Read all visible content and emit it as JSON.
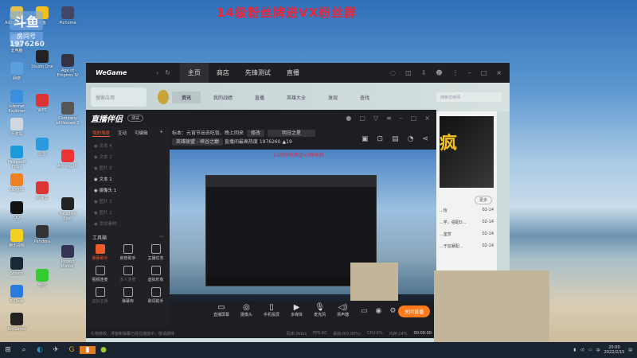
{
  "overlay": {
    "banner": "14级粉丝牌进VX粉丝群",
    "logo": "斗鱼",
    "room_label": "房间号",
    "room_id": "1976260"
  },
  "desktop_icons": [
    {
      "label": "Administrator",
      "color": "#e6c24a"
    },
    {
      "label": "此电脑",
      "color": "#7fb0e0"
    },
    {
      "label": "网络",
      "color": "#5aa0e0"
    },
    {
      "label": "Internet Explorer",
      "color": "#3a8fe0"
    },
    {
      "label": "回收站",
      "color": "#d0d8e0"
    },
    {
      "label": "Microsoft Edge",
      "color": "#1a9ad8"
    },
    {
      "label": "QQ游戏",
      "color": "#f08020"
    },
    {
      "label": "QQ",
      "color": "#111"
    },
    {
      "label": "腾讯视频",
      "color": "#f4d020"
    },
    {
      "label": "Steam",
      "color": "#1b2838"
    },
    {
      "label": "ToDesk",
      "color": "#2a7ae0"
    },
    {
      "label": "WeGame",
      "color": "#222"
    },
    {
      "label": "斗鱼",
      "color": "#f4c020"
    },
    {
      "label": "Studio One",
      "color": "#222"
    },
    {
      "label": "WPS",
      "color": "#d33"
    },
    {
      "label": "迅雷",
      "color": "#2a9ae0"
    },
    {
      "label": "网易云",
      "color": "#d33"
    },
    {
      "label": "Pandora",
      "color": "#333"
    },
    {
      "label": "微信",
      "color": "#3c3"
    },
    {
      "label": "Pichome",
      "color": "#446"
    },
    {
      "label": "Age of Empires IV",
      "color": "#334"
    },
    {
      "label": "Company of Heroes 2",
      "color": "#555"
    },
    {
      "label": "Among Us",
      "color": "#e33"
    },
    {
      "label": "Paradise Lost",
      "color": "#222"
    },
    {
      "label": "Project Winter",
      "color": "#335"
    }
  ],
  "wegame": {
    "brand": "WeGame",
    "nav": [
      "主页",
      "商店",
      "先锋测试",
      "直播"
    ],
    "search_placeholder": "搜索应用",
    "sub_tabs": [
      "资讯",
      "我的战绩",
      "直播",
      "英雄大全",
      "发现",
      "查找"
    ],
    "search2_placeholder": "搜索召唤师",
    "poster_text": "疯",
    "more": "更多",
    "news": [
      {
        "title": "...怡",
        "date": "02-14"
      },
      {
        "title": "...学，强配D...",
        "date": "02-14"
      },
      {
        "title": "...鉴赏",
        "date": "02-14"
      },
      {
        "title": "...于狂暴配...",
        "date": "02-14"
      }
    ]
  },
  "zhibo": {
    "brand": "直播伴侣",
    "version": "测试",
    "tabs": [
      "我的场景",
      "互动",
      "可编辑"
    ],
    "scenes": [
      {
        "name": "文本 4",
        "on": false
      },
      {
        "name": "文本 2",
        "on": false
      },
      {
        "name": "图片 5",
        "on": false
      },
      {
        "name": "文本 1",
        "on": true
      },
      {
        "name": "摄像头 1",
        "on": true
      },
      {
        "name": "图片 1",
        "on": false
      },
      {
        "name": "图片 2",
        "on": false
      },
      {
        "name": "添加素材",
        "on": false
      }
    ],
    "toolbox": "工具箱",
    "tools": [
      {
        "label": "弹幕助手",
        "style": "org"
      },
      {
        "label": "房管助手",
        "style": ""
      },
      {
        "label": "主播任务",
        "style": ""
      },
      {
        "label": "视频连麦",
        "style": ""
      },
      {
        "label": "多人连麦",
        "style": "dis"
      },
      {
        "label": "虚拟形象",
        "style": ""
      },
      {
        "label": "虚拟主播",
        "style": "dis"
      },
      {
        "label": "弹幕库",
        "style": ""
      },
      {
        "label": "歌词助手",
        "style": ""
      }
    ],
    "title_line": "标本：元宵节出去吃饭，晚上回来",
    "edit": "修改",
    "category": "明日之星",
    "game": "英雄联盟 - 峡谷之巅",
    "room_info": "直播间最高热度",
    "room_id": "1976260",
    "fans": "19",
    "controls": [
      "直播屏幕",
      "摄像头",
      "手机投屏",
      "多媒体",
      "麦克风",
      "扬声器"
    ],
    "stop": "关闭直播",
    "notice": "礼物特效、浮窗和弹幕已经在播放中，敬请期待",
    "status": [
      "码率:0kb/s",
      "FPS:60",
      "丢帧:0(0.00%)",
      "CPU:6%",
      "内存:24%"
    ],
    "timer": "00:00:00"
  },
  "taskbar": {
    "time": "20:00",
    "date": "2022/2/15",
    "lang": "中"
  }
}
